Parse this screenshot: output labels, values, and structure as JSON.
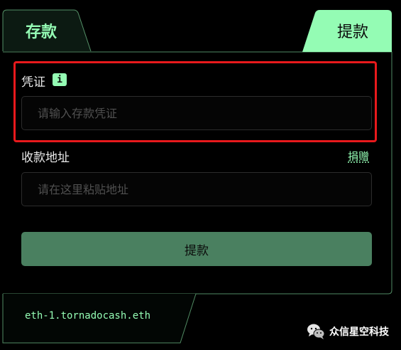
{
  "tabs": {
    "deposit_label": "存款",
    "withdraw_label": "提款"
  },
  "note_field": {
    "label": "凭证",
    "info_badge": "i",
    "placeholder": "请输入存款凭证",
    "value": ""
  },
  "recipient_field": {
    "label": "收款地址",
    "donate_link": "捐赠",
    "placeholder": "请在这里粘贴地址",
    "value": ""
  },
  "submit": {
    "label": "提款"
  },
  "footer": {
    "domain": "eth-1.tornadocash.eth"
  },
  "watermark": {
    "text": "众信星空科技",
    "icon": "wechat-icon"
  },
  "colors": {
    "accent": "#94fcb4",
    "button": "#4a8060",
    "highlight": "#e8191c",
    "background": "#000000"
  }
}
